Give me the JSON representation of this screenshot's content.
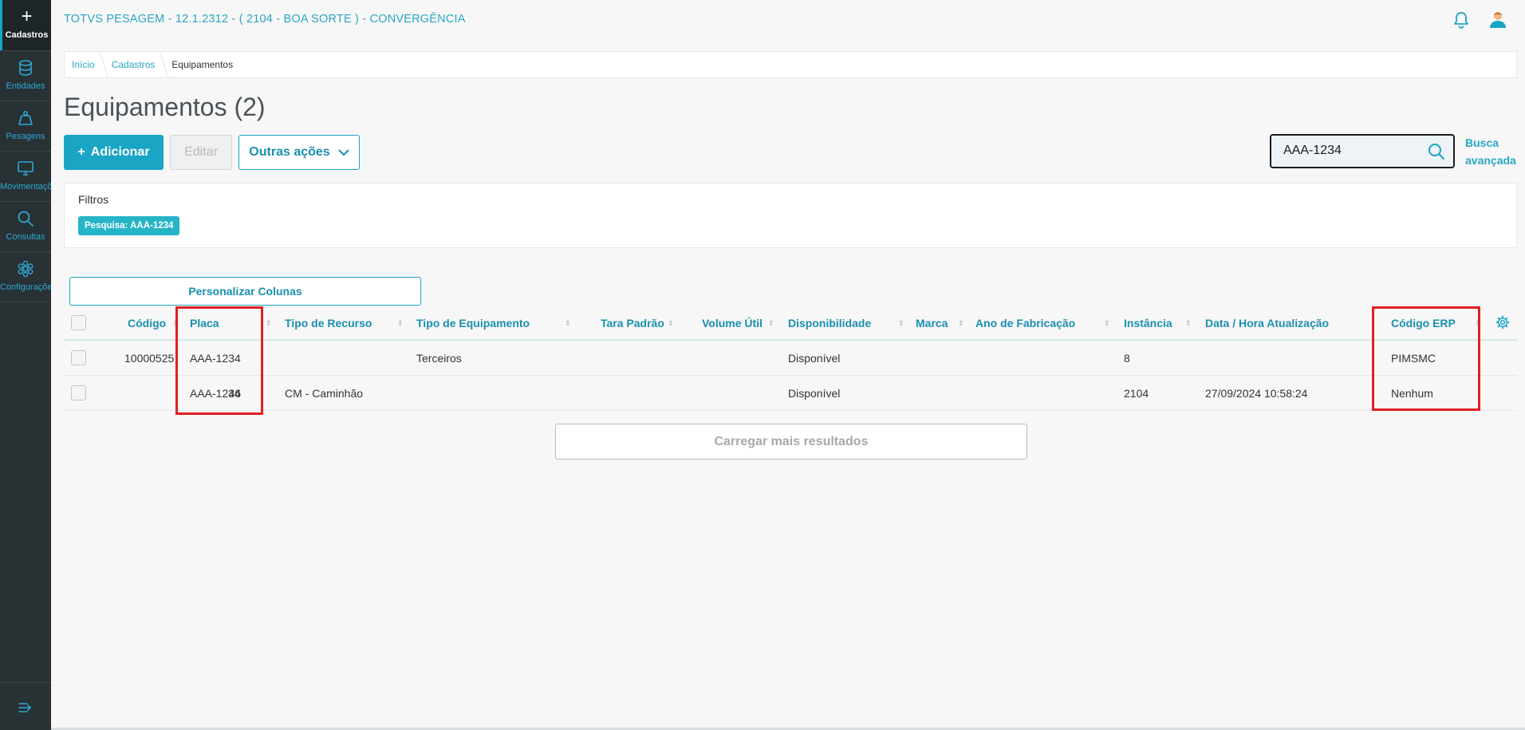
{
  "app": {
    "title": "TOTVS PESAGEM - 12.1.2312 - ( 2104 - BOA SORTE ) - CONVERGÊNCIA"
  },
  "sidebar": {
    "items": [
      {
        "label": "Cadastros",
        "icon": "plus-icon",
        "active": true
      },
      {
        "label": "Entidades",
        "icon": "database-icon"
      },
      {
        "label": "Pesagens",
        "icon": "weight-icon"
      },
      {
        "label": "Movimentações",
        "icon": "monitor-icon"
      },
      {
        "label": "Consultas",
        "icon": "search-icon"
      },
      {
        "label": "Configurações",
        "icon": "gear-icon"
      }
    ],
    "collapse_icon": "collapse-menu-icon"
  },
  "breadcrumb": [
    "Início",
    "Cadastros",
    "Equipamentos"
  ],
  "page": {
    "title": "Equipamentos (2)"
  },
  "toolbar": {
    "add_label": "Adicionar",
    "edit_label": "Editar",
    "more_label": "Outras ações"
  },
  "search": {
    "value": "AAA-1234",
    "advanced_line1": "Busca",
    "advanced_line2": "avançada"
  },
  "filters": {
    "title": "Filtros",
    "chip": "Pesquisa: AAA-1234"
  },
  "table": {
    "customize_label": "Personalizar Colunas",
    "columns": [
      "Código",
      "Placa",
      "Tipo de Recurso",
      "Tipo de Equipamento",
      "Tara Padrão",
      "Volume Útil",
      "Disponibilidade",
      "Marca",
      "Ano de Fabricação",
      "Instância",
      "Data / Hora Atualização",
      "Código ERP"
    ],
    "rows": [
      {
        "codigo": "10000525",
        "placa": "AAA-1234",
        "tipo_recurso": "",
        "tipo_equipamento": "Terceiros",
        "tara": "",
        "volume": "",
        "disponibilidade": "Disponível",
        "marca": "",
        "ano": "",
        "instancia": "8",
        "data_hora": "",
        "codigo_erp": "PIMSMC"
      },
      {
        "codigo": "46",
        "placa": "AAA-1234",
        "tipo_recurso": "CM - Caminhão",
        "tipo_equipamento": "",
        "tara": "",
        "volume": "",
        "disponibilidade": "Disponível",
        "marca": "",
        "ano": "",
        "instancia": "2104",
        "data_hora": "27/09/2024 10:58:24",
        "codigo_erp": "Nenhum"
      }
    ],
    "load_more_label": "Carregar mais resultados"
  },
  "colors": {
    "accent": "#1aa5c4",
    "sidebar_bg": "#283134",
    "highlight": "#e02020"
  }
}
